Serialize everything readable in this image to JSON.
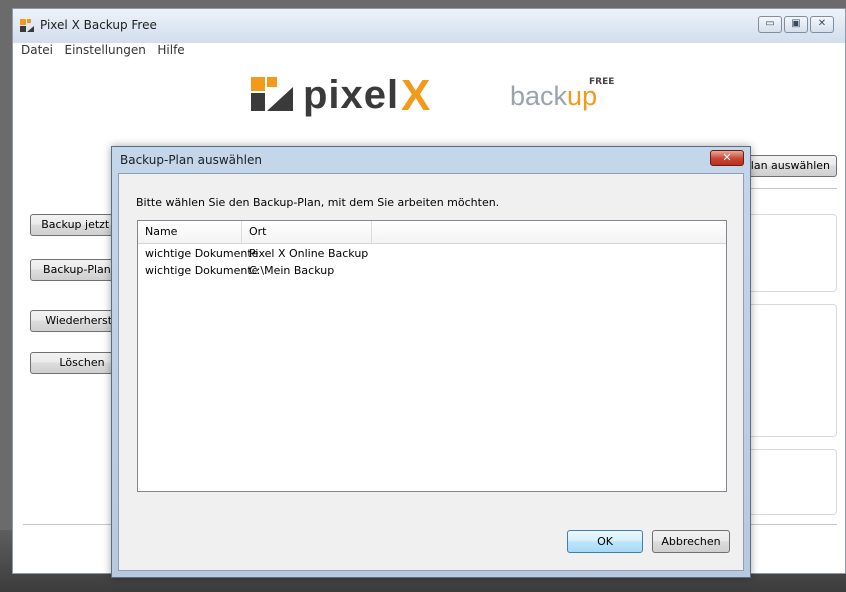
{
  "window": {
    "title": "Pixel X Backup Free",
    "controls": {
      "minimize": "▭",
      "maximize": "▣",
      "close": "✕"
    }
  },
  "menu": {
    "items": [
      "Datei",
      "Einstellungen",
      "Hilfe"
    ]
  },
  "logo": {
    "brand": "pixel",
    "brand_x": "X",
    "product": "back",
    "product_accent": "up",
    "edition": "FREE"
  },
  "main": {
    "buttons": {
      "backup_now": "Backup jetzt st",
      "change_plan": "Backup-Plan ä",
      "restore": "Wiederherste",
      "delete": "Löschen",
      "select_plan": "lan auswählen"
    }
  },
  "dialog": {
    "title": "Backup-Plan auswählen",
    "close": "✕",
    "instruction": "Bitte wählen Sie den Backup-Plan, mit dem Sie arbeiten möchten.",
    "columns": [
      "Name",
      "Ort"
    ],
    "rows": [
      {
        "name": "wichtige Dokumente",
        "location": "Pixel X Online Backup"
      },
      {
        "name": "wichtige Dokumente",
        "location": "C:\\Mein Backup"
      }
    ],
    "ok_label": "OK",
    "cancel_label": "Abbrechen"
  },
  "colors": {
    "accent_orange": "#f39a1a",
    "close_red": "#c74534",
    "dialog_frame": "#c4d6ea"
  }
}
